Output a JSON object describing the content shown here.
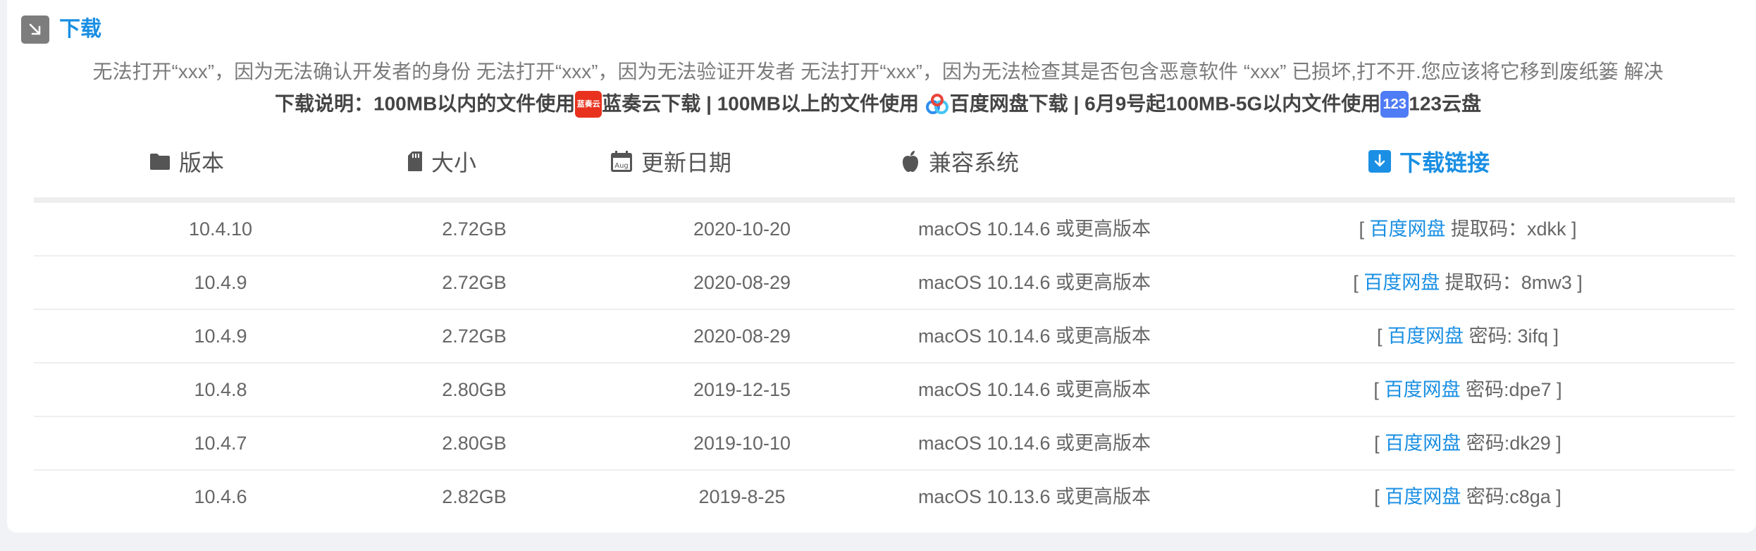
{
  "section": {
    "title": "下载",
    "icon": "arrow-down-right-icon"
  },
  "notices": {
    "line1": "无法打开“xxx”，因为无法确认开发者的身份 无法打开“xxx”，因为无法验证开发者 无法打开“xxx”，因为无法检查其是否包含恶意软件 “xxx” 已损坏,打不开.您应该将它移到废纸篓 解决",
    "line2_part1": "下载说明：100MB以内的文件使用",
    "lanzou_badge": "蓝奏云",
    "lanzou_label": "蓝奏云下载",
    "line2_part2": " | 100MB以上的文件使用",
    "baidu_label": "百度网盘下载",
    "line2_part3": " | 6月9号起100MB-5G以内文件使用",
    "pan123_badge": "123",
    "pan123_label": "123云盘"
  },
  "table": {
    "headers": {
      "version": "版本",
      "size": "大小",
      "date": "更新日期",
      "compat": "兼容系统",
      "download": "下载链接"
    },
    "header_icons": {
      "version": "folder-icon",
      "size": "sd-card-icon",
      "date": "calendar-icon",
      "compat": "apple-icon",
      "download": "download-icon"
    },
    "link_text": "百度网盘",
    "bracket_open": "[",
    "bracket_close": "]",
    "rows": [
      {
        "version": "10.4.10",
        "size": "2.72GB",
        "date": "2020-10-20",
        "compat": "macOS 10.14.6 或更高版本",
        "code": "提取码：xdkk"
      },
      {
        "version": "10.4.9",
        "size": "2.72GB",
        "date": "2020-08-29",
        "compat": "macOS 10.14.6 或更高版本",
        "code": "提取码：8mw3"
      },
      {
        "version": "10.4.9",
        "size": "2.72GB",
        "date": "2020-08-29",
        "compat": "macOS 10.14.6 或更高版本",
        "code": "密码: 3ifq"
      },
      {
        "version": "10.4.8",
        "size": "2.80GB",
        "date": "2019-12-15",
        "compat": "macOS 10.14.6 或更高版本",
        "code": "密码:dpe7"
      },
      {
        "version": "10.4.7",
        "size": "2.80GB",
        "date": "2019-10-10",
        "compat": "macOS 10.14.6 或更高版本",
        "code": "密码:dk29"
      },
      {
        "version": "10.4.6",
        "size": "2.82GB",
        "date": "2019-8-25",
        "compat": "macOS 10.13.6 或更高版本",
        "code": "密码:c8ga"
      }
    ]
  },
  "colors": {
    "accent": "#1a8fe3",
    "lanzou": "#e8321e",
    "pan123": "#4f7cf5"
  }
}
